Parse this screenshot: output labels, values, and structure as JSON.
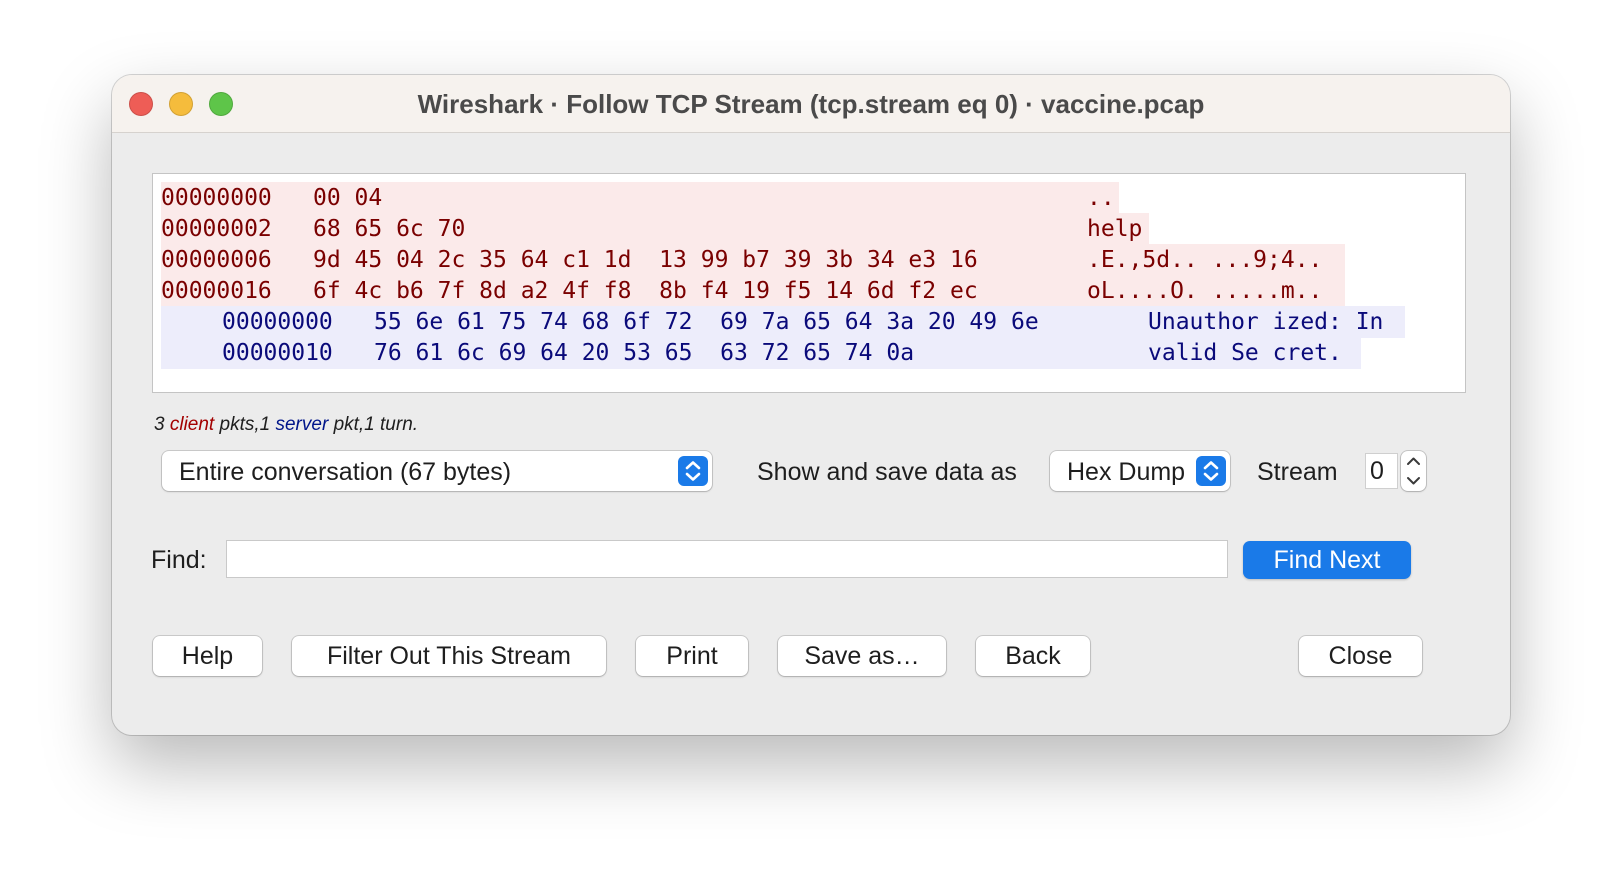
{
  "window": {
    "title": "Wireshark · Follow TCP Stream (tcp.stream eq 0) · vaccine.pcap"
  },
  "stream_content": {
    "client_lines": [
      {
        "offset": "00000000",
        "hex": "00 04",
        "ascii": ".."
      },
      {
        "offset": "00000002",
        "hex": "68 65 6c 70",
        "ascii": "help"
      },
      {
        "offset": "00000006",
        "hex": "9d 45 04 2c 35 64 c1 1d  13 99 b7 39 3b 34 e3 16",
        "ascii": ".E.,5d.. ...9;4.."
      },
      {
        "offset": "00000016",
        "hex": "6f 4c b6 7f 8d a2 4f f8  8b f4 19 f5 14 6d f2 ec",
        "ascii": "oL....O. .....m.."
      }
    ],
    "server_lines": [
      {
        "offset": "00000000",
        "hex": "55 6e 61 75 74 68 6f 72  69 7a 65 64 3a 20 49 6e",
        "ascii": "Unauthor ized: In"
      },
      {
        "offset": "00000010",
        "hex": "76 61 6c 69 64 20 53 65  63 72 65 74 0a",
        "ascii": "valid Se cret."
      }
    ]
  },
  "summary": {
    "client_count": "3",
    "client_word": "client",
    "client_tail": "pkts,1",
    "server_word": "server",
    "server_tail": "pkt,1 turn."
  },
  "controls": {
    "conversation_select": "Entire conversation (67 bytes)",
    "show_save_label": "Show and save data as",
    "format_select": "Hex Dump",
    "stream_label": "Stream",
    "stream_value": "0",
    "find_label": "Find:",
    "find_value": "",
    "find_next": "Find Next"
  },
  "buttons": {
    "help": "Help",
    "filter_out": "Filter Out This Stream",
    "print": "Print",
    "save_as": "Save as…",
    "back": "Back",
    "close": "Close"
  },
  "colors": {
    "client_text": "#7a0000",
    "client_bg": "#fbeaea",
    "server_text": "#0a0a7a",
    "server_bg": "#ededfb",
    "accent": "#1a7ae8"
  }
}
